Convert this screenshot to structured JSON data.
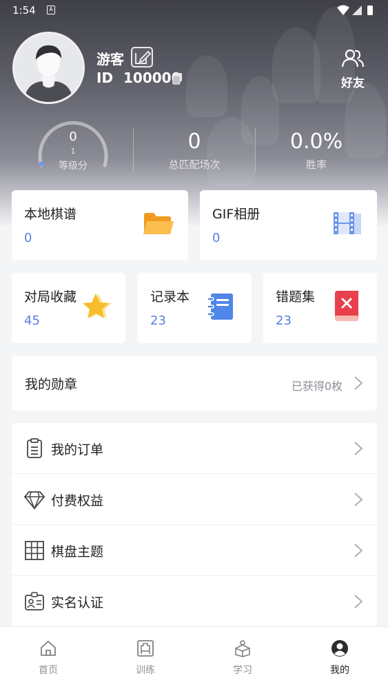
{
  "status_bar": {
    "time": "1:54",
    "notification_glyph": "A"
  },
  "profile": {
    "name": "游客",
    "id_label": "ID",
    "id_value": "100000",
    "friends_label": "好友"
  },
  "stats": {
    "level_value": "0",
    "level_sub": "1",
    "level_label": "等级分",
    "matches_value": "0",
    "matches_label": "总匹配场次",
    "win_rate_value": "0.0%",
    "win_rate_label": "胜率"
  },
  "cards_top": [
    {
      "title": "本地棋谱",
      "count": "0",
      "icon": "folder-icon"
    },
    {
      "title": "GIF相册",
      "count": "0",
      "icon": "film-icon"
    }
  ],
  "cards_mid": [
    {
      "title": "对局收藏",
      "count": "45",
      "icon": "star-icon"
    },
    {
      "title": "记录本",
      "count": "23",
      "icon": "notebook-icon"
    },
    {
      "title": "错题集",
      "count": "23",
      "icon": "error-book-icon"
    }
  ],
  "medals": {
    "label": "我的勋章",
    "status": "已获得0枚"
  },
  "menu": [
    {
      "label": "我的订单",
      "icon": "order-icon"
    },
    {
      "label": "付费权益",
      "icon": "diamond-icon"
    },
    {
      "label": "棋盘主题",
      "icon": "board-grid-icon"
    },
    {
      "label": "实名认证",
      "icon": "id-card-icon"
    }
  ],
  "nav": [
    {
      "label": "首页",
      "icon": "home-icon"
    },
    {
      "label": "训练",
      "icon": "training-icon"
    },
    {
      "label": "学习",
      "icon": "study-icon"
    },
    {
      "label": "我的",
      "icon": "profile-icon",
      "active": true
    }
  ],
  "colors": {
    "accent": "#5b7de0",
    "folder": "#f7a531",
    "star": "#f8c33a",
    "notebook": "#4f86e8",
    "error_book": "#e8404d",
    "film": "#6e96e6"
  }
}
